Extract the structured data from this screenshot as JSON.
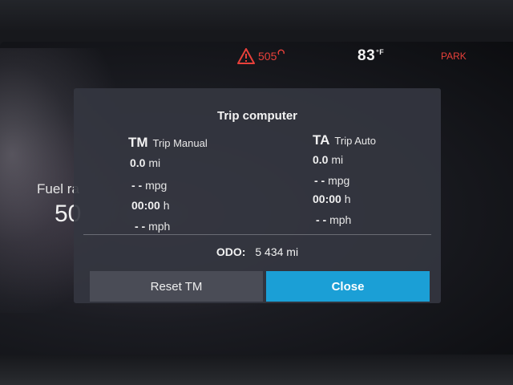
{
  "status_bar": {
    "warning_code": "505",
    "warning_color": "#e8403a",
    "temperature": "83",
    "temperature_unit": "°F",
    "gear": "PARK",
    "gear_color": "#e8403a"
  },
  "background": {
    "fuel_label": "Fuel ra",
    "fuel_value": "50"
  },
  "dialog": {
    "title": "Trip computer",
    "trip_manual": {
      "abbr": "TM",
      "label": "Trip Manual",
      "distance_value": "0.0",
      "distance_unit": "mi",
      "mpg_value": "- -",
      "mpg_unit": "mpg",
      "time_value": "00:00",
      "time_unit": "h",
      "speed_value": "- -",
      "speed_unit": "mph"
    },
    "trip_auto": {
      "abbr": "TA",
      "label": "Trip Auto",
      "distance_value": "0.0",
      "distance_unit": "mi",
      "mpg_value": "- -",
      "mpg_unit": "mpg",
      "time_value": "00:00",
      "time_unit": "h",
      "speed_value": "- -",
      "speed_unit": "mph"
    },
    "odometer": {
      "label": "ODO:",
      "value": "5 434",
      "unit": "mi"
    },
    "buttons": {
      "reset_label": "Reset TM",
      "close_label": "Close",
      "close_color": "#1b9fd6"
    }
  }
}
